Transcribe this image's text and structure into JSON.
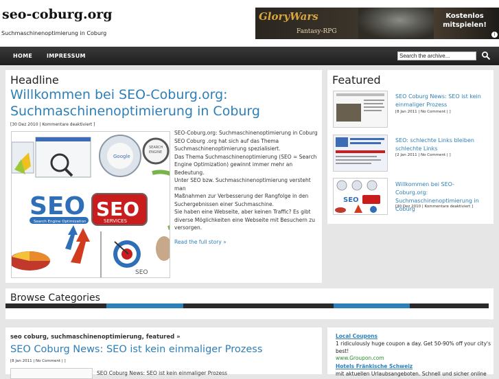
{
  "site": {
    "title": "seo-coburg.org",
    "tagline": "Suchmaschinenoptimierung in Coburg"
  },
  "banner": {
    "logo": "GloryWars",
    "sub": "Fantasy-RPG",
    "cta_line1": "Kostenlos",
    "cta_line2": "mitspielen!",
    "info": "i"
  },
  "nav": {
    "items": [
      "HOME",
      "IMPRESSUM"
    ],
    "search_value": "Search the archive..."
  },
  "headline": {
    "label": "Headline",
    "title_line1": "Willkommen bei SEO-Coburg.org:",
    "title_line2": "Suchmaschinenoptimierung in Coburg",
    "meta": "[30 Dez 2010 | Kommentare deaktiviert ]",
    "body": [
      "SEO-Coburg.org: Suchmaschinenoptimierung in Coburg",
      "SEO Coburg .org hat sich auf das Thema",
      "Suchmaschinenoptimierung spezialisiert.",
      "Das Thema Suchmaschinenoptimierung (SEO = Search",
      "Engine Optimization) gewinnt immer mehr an Bedeutung.",
      "Unter SEO bzw. Suchmaschinenoptimierung versteht man",
      "Maßnahmen zur Verbesserung der Rangfolge in den",
      "Suchergebnissen einer Suchmaschine.",
      "Sie haben eine Webseite, aber keinen Traffic? Es gibt",
      "diverse Möglichkeiten eine Webseite mit Besuchern zu",
      "versorgen."
    ],
    "read_more": "Read the full story »",
    "image_text": {
      "seo_blue": "SEO",
      "seo_blue_sub": "Search Engine Optimization",
      "seo_red": "SEO",
      "seo_red_sub": "SERVICES",
      "seo_small": "SEO"
    }
  },
  "featured": {
    "label": "Featured",
    "items": [
      {
        "title_lines": [
          "SEO Coburg News: SEO ist kein",
          "einmaliger Prozess"
        ],
        "meta": "[8 Jan 2011 | No Comment | ]"
      },
      {
        "title_lines": [
          "SEO: schlechte Links bleiben",
          "schlechte Links"
        ],
        "meta": "[2 Jan 2011 | No Comment | ]"
      },
      {
        "title_lines": [
          "Willkommen bei SEO-Coburg.org:",
          "Suchmaschinenoptimierung in",
          "Coburg"
        ],
        "meta": "[30 Dez 2010 | Kommentare deaktiviert ]"
      }
    ]
  },
  "browse": {
    "title": "Browse Categories"
  },
  "bottom": {
    "categories": "seo coburg, suchmaschinenoptimierung, featured »",
    "post_title": "SEO Coburg News: SEO ist kein einmaliger Prozess",
    "post_meta": "[8 Jan 2011 | No Comment | ]",
    "post_excerpt": "SEO Coburg News: SEO ist kein einmaliger Prozess",
    "ad_title1": "Local Coupons",
    "ad_text1": "1 ridiculously huge coupon a day. Get 50-90% off your city's best!",
    "ad_url1": "www.Groupon.com",
    "ad_title2": "Hotels Fränkische Schweiz",
    "ad_text2": "mit aktuellen Urlaubsangeboten. Schnell und sicher online"
  },
  "colors": {
    "link": "#2d7fb8",
    "stripe_dark": "#2a2a2a",
    "stripe_blue": "#2d7fb8",
    "ad_url": "#2a8a2a"
  }
}
